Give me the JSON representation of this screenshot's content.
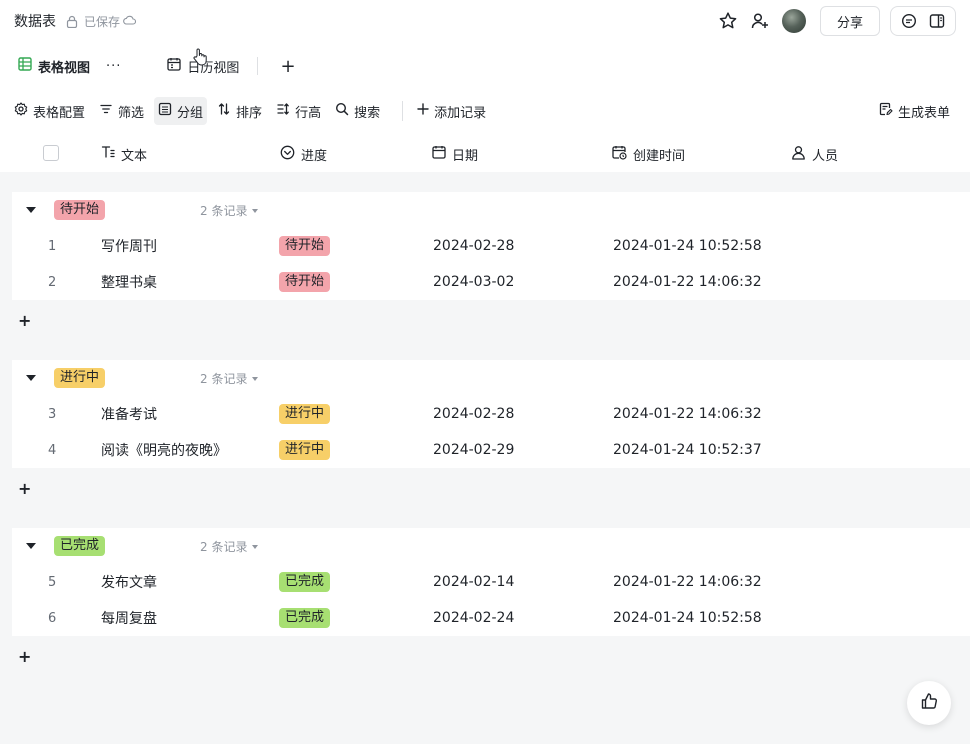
{
  "topbar": {
    "title": "数据表",
    "saved": "已保存",
    "share": "分享"
  },
  "tabs": [
    {
      "label": "表格视图",
      "icon": "grid-icon"
    },
    {
      "label": "日历视图",
      "icon": "calendar-icon"
    }
  ],
  "tab_more": "···",
  "tab_add": "+",
  "toolbar": {
    "config": "表格配置",
    "filter": "筛选",
    "group": "分组",
    "sort": "排序",
    "row_height": "行高",
    "search": "搜索",
    "add_record": "添加记录",
    "gen_form": "生成表单"
  },
  "columns": {
    "text": "文本",
    "progress": "进度",
    "date": "日期",
    "created": "创建时间",
    "person": "人员"
  },
  "groups": [
    {
      "label": "待开始",
      "count": "2 条记录",
      "color": "#f3a4ab",
      "rows": [
        {
          "idx": "1",
          "text": "写作周刊",
          "progress": "待开始",
          "date": "2024-02-28",
          "created": "2024-01-24 10:52:58"
        },
        {
          "idx": "2",
          "text": "整理书桌",
          "progress": "待开始",
          "date": "2024-03-02",
          "created": "2024-01-22 14:06:32"
        }
      ]
    },
    {
      "label": "进行中",
      "count": "2 条记录",
      "color": "#f7cf68",
      "rows": [
        {
          "idx": "3",
          "text": "准备考试",
          "progress": "进行中",
          "date": "2024-02-28",
          "created": "2024-01-22 14:06:32"
        },
        {
          "idx": "4",
          "text": "阅读《明亮的夜晚》",
          "progress": "进行中",
          "date": "2024-02-29",
          "created": "2024-01-24 10:52:37"
        }
      ]
    },
    {
      "label": "已完成",
      "count": "2 条记录",
      "color": "#a7df72",
      "rows": [
        {
          "idx": "5",
          "text": "发布文章",
          "progress": "已完成",
          "date": "2024-02-14",
          "created": "2024-01-22 14:06:32"
        },
        {
          "idx": "6",
          "text": "每周复盘",
          "progress": "已完成",
          "date": "2024-02-24",
          "created": "2024-01-24 10:52:58"
        }
      ]
    }
  ],
  "add_symbol": "+"
}
